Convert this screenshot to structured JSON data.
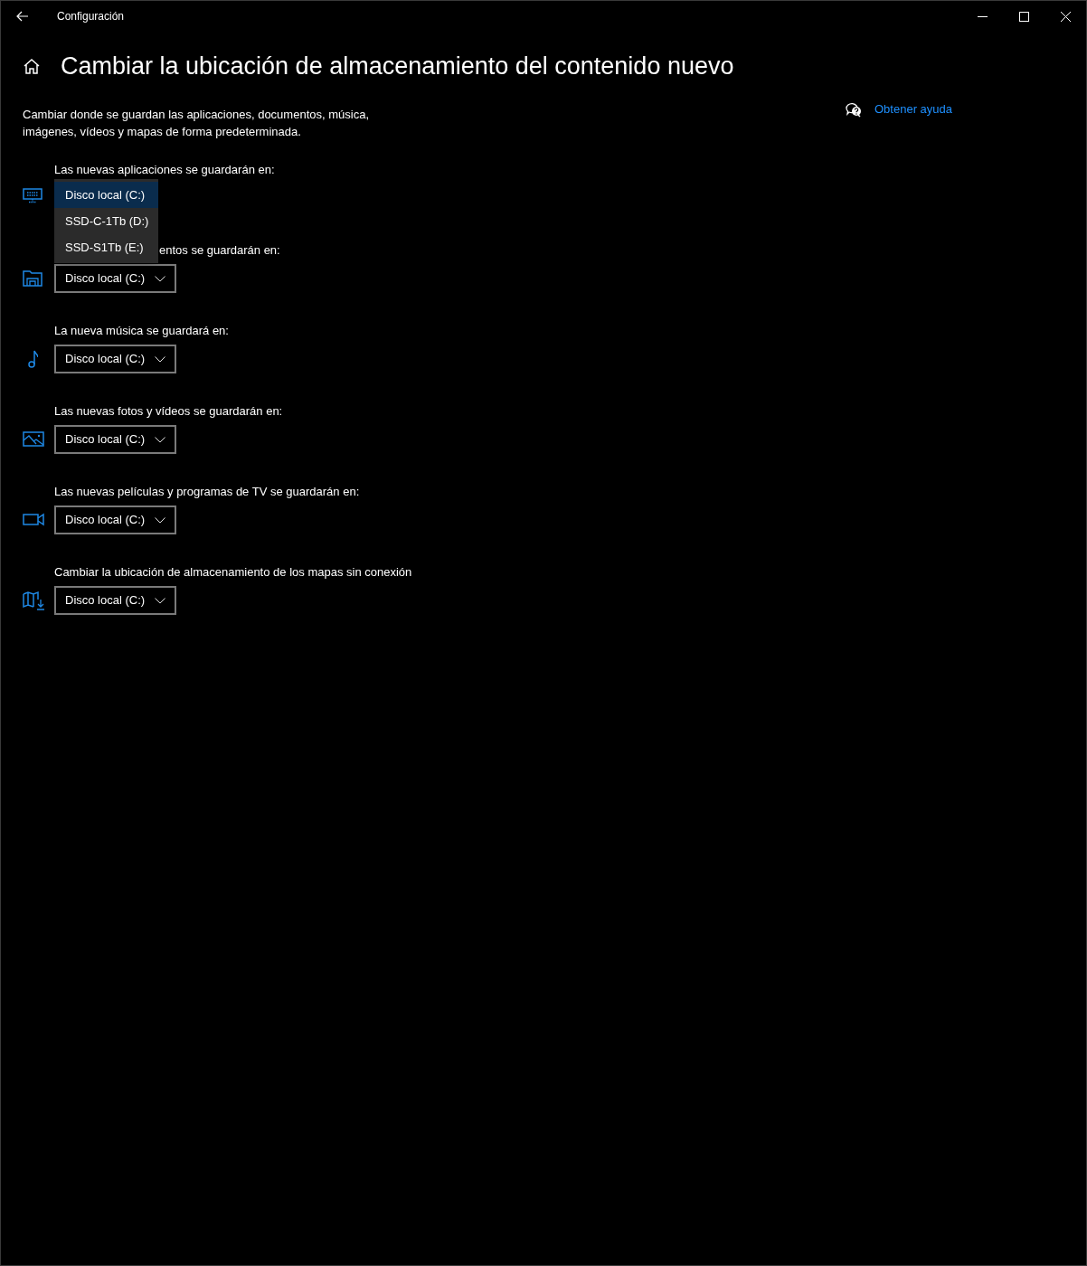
{
  "window": {
    "title": "Configuración"
  },
  "page_title": "Cambiar la ubicación de almacenamiento del contenido nuevo",
  "description": "Cambiar donde se guardan las aplicaciones, documentos, música, imágenes, vídeos y mapas de forma predeterminada.",
  "help_link": "Obtener ayuda",
  "sections": [
    {
      "kind": "apps",
      "label": "Las nuevas aplicaciones se guardarán en:",
      "open": true,
      "options": [
        {
          "label": "Disco local (C:)",
          "selected": true
        },
        {
          "label": "SSD-C-1Tb (D:)",
          "selected": false
        },
        {
          "label": "SSD-S1Tb (E:)",
          "selected": false
        }
      ]
    },
    {
      "kind": "documents",
      "label": "entos se guardarán en:",
      "label_covered": true,
      "open": false,
      "value": "Disco local (C:)"
    },
    {
      "kind": "music",
      "label": "La nueva música se guardará en:",
      "open": false,
      "value": "Disco local (C:)"
    },
    {
      "kind": "photos",
      "label": "Las nuevas fotos y vídeos se guardarán en:",
      "open": false,
      "value": "Disco local (C:)"
    },
    {
      "kind": "movies",
      "label": "Las nuevas películas y programas de TV se guardarán en:",
      "open": false,
      "value": "Disco local (C:)"
    },
    {
      "kind": "maps",
      "label": "Cambiar la ubicación de almacenamiento de los mapas sin conexión",
      "open": false,
      "value": "Disco local (C:)"
    }
  ]
}
